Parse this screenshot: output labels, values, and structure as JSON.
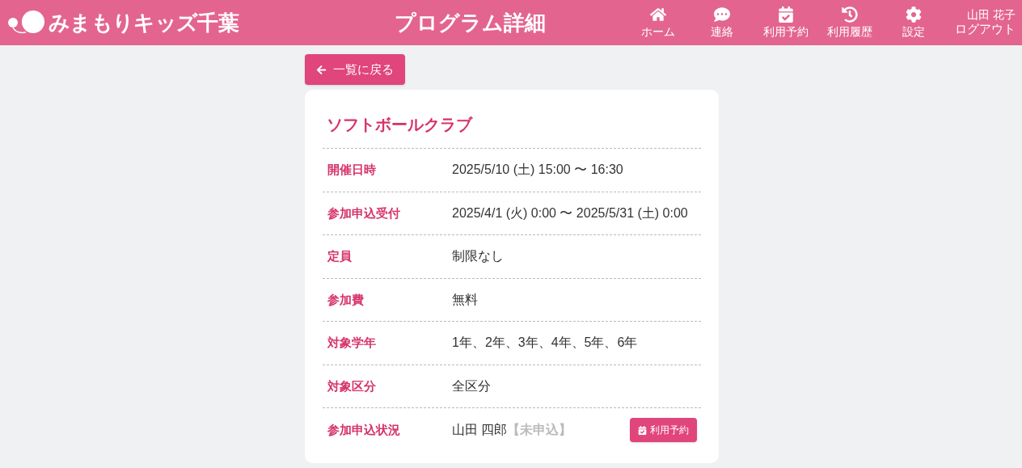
{
  "header": {
    "logo": "みまもりキッズ千葉",
    "title": "プログラム詳細",
    "nav": [
      {
        "kind": "home",
        "label": "ホーム"
      },
      {
        "kind": "chat",
        "label": "連絡"
      },
      {
        "kind": "calendar",
        "label": "利用予約"
      },
      {
        "kind": "history",
        "label": "利用履歴"
      },
      {
        "kind": "settings",
        "label": "設定"
      }
    ],
    "user": {
      "name": "山田 花子",
      "logout": "ログアウト"
    }
  },
  "back_button": "一覧に戻る",
  "program": {
    "title": "ソフトボールクラブ",
    "rows": [
      {
        "label": "開催日時",
        "value": "2025/5/10 (土) 15:00 〜 16:30"
      },
      {
        "label": "参加申込受付",
        "value": "2025/4/1 (火) 0:00 〜 2025/5/31 (土) 0:00"
      },
      {
        "label": "定員",
        "value": "制限なし"
      },
      {
        "label": "参加費",
        "value": "無料"
      },
      {
        "label": "対象学年",
        "value": "1年、2年、3年、4年、5年、6年"
      },
      {
        "label": "対象区分",
        "value": "全区分"
      }
    ],
    "status": {
      "label": "参加申込状況",
      "child": "山田 四郎",
      "state": "【未申込】",
      "button": "利用予約"
    }
  }
}
